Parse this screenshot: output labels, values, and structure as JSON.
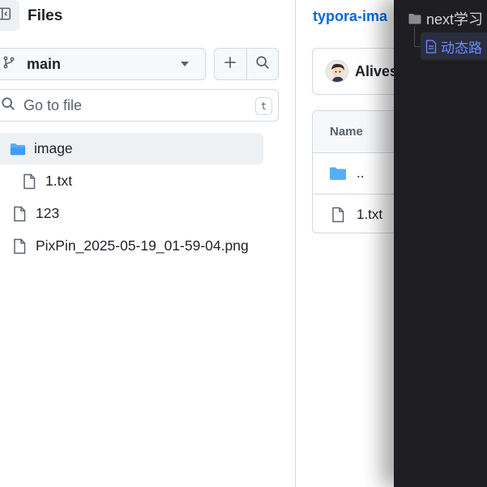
{
  "sidebar": {
    "title": "Files",
    "branch": "main",
    "search_placeholder": "Go to file",
    "shortcut_key": "t",
    "tree": [
      {
        "label": "image",
        "type": "folder",
        "selected": true
      },
      {
        "label": "1.txt",
        "type": "file"
      },
      {
        "label": "123",
        "type": "file"
      },
      {
        "label": "PixPin_2025-05-19_01-59-04.png",
        "type": "file"
      }
    ]
  },
  "main": {
    "breadcrumb": "typora-ima",
    "commit_author": "Alives",
    "table": {
      "header": "Name",
      "rows": [
        {
          "label": "..",
          "type": "folder"
        },
        {
          "label": "1.txt",
          "type": "file"
        }
      ]
    }
  },
  "overlay": {
    "folder": "next学习",
    "file": "动态路"
  },
  "colors": {
    "accent": "#0969da",
    "folder": "#54aeff",
    "border": "#d1d9e0",
    "dark_bg": "#1e1e22",
    "dark_link": "#6b8cff"
  }
}
